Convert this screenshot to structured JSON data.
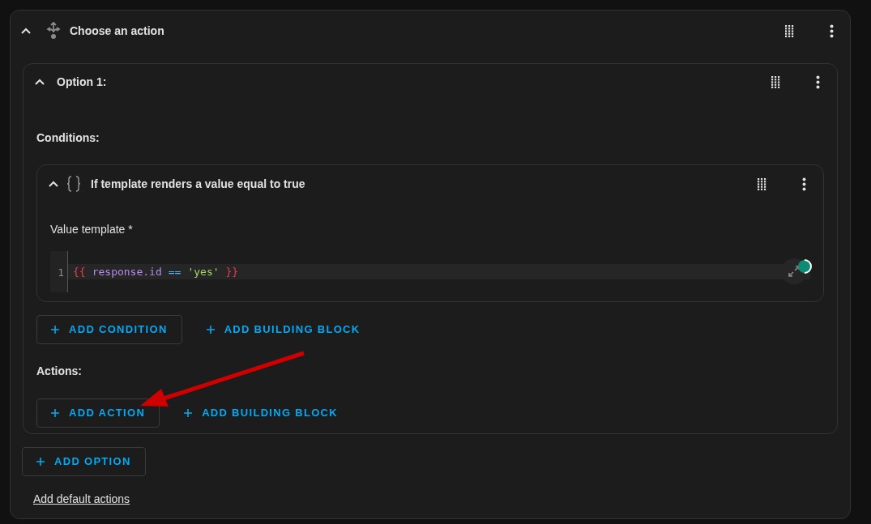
{
  "card": {
    "title": "Choose an action",
    "expanded": true,
    "option": {
      "title": "Option 1:",
      "expanded": true,
      "conditions_label": "Conditions:",
      "condition": {
        "title": "If template renders a value equal to true",
        "expanded": true,
        "field_label": "Value template *",
        "code": {
          "line_number": "1",
          "tokens": [
            {
              "kind": "brace",
              "text": "{{"
            },
            {
              "kind": "variable",
              "text": "response.id"
            },
            {
              "kind": "operator",
              "text": "=="
            },
            {
              "kind": "string",
              "text": "'yes'"
            },
            {
              "kind": "brace",
              "text": "}}"
            }
          ]
        }
      },
      "condition_buttons": [
        {
          "label": "ADD CONDITION",
          "outlined": true
        },
        {
          "label": "ADD BUILDING BLOCK",
          "outlined": false
        }
      ],
      "actions_label": "Actions:",
      "action_buttons": [
        {
          "label": "ADD ACTION",
          "outlined": true
        },
        {
          "label": "ADD BUILDING BLOCK",
          "outlined": false
        }
      ]
    },
    "option_buttons": [
      {
        "label": "ADD OPTION",
        "outlined": true
      }
    ],
    "link": "Add default actions"
  }
}
